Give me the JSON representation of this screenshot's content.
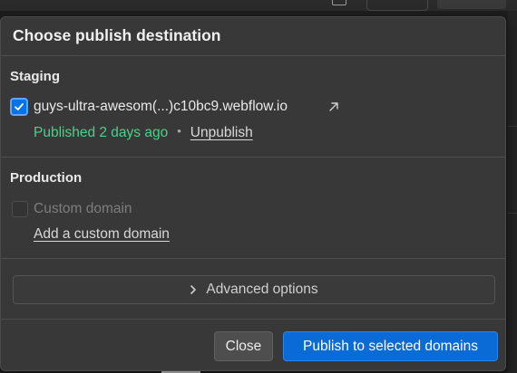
{
  "dialog": {
    "title": "Choose publish destination"
  },
  "staging": {
    "title": "Staging",
    "domain": "guys-ultra-awesom(...)c10bc9.webflow.io",
    "checked": true,
    "status": "Published 2 days ago",
    "separator": "•",
    "unpublish_label": "Unpublish"
  },
  "production": {
    "title": "Production",
    "domain_placeholder": "Custom domain",
    "checked": false,
    "add_domain_label": "Add a custom domain"
  },
  "advanced": {
    "label": "Advanced options"
  },
  "footer": {
    "close_label": "Close",
    "publish_label": "Publish to selected domains"
  },
  "colors": {
    "accent": "#0a6ad6",
    "published_green": "#4ad18a",
    "panel_bg": "#383838"
  }
}
